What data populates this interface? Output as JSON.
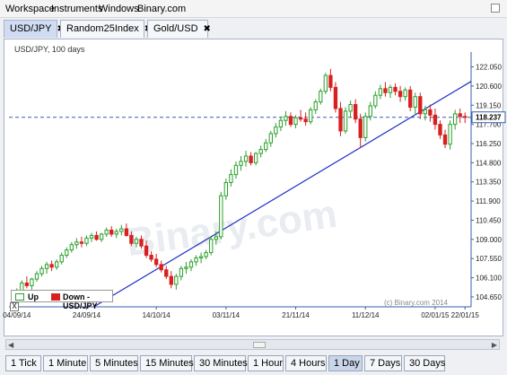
{
  "menu": {
    "workspace": "Workspace",
    "instruments": "Instruments",
    "windows": "Windows",
    "binary": "Binary.com"
  },
  "tabs": [
    {
      "label": "USD/JPY",
      "active": true
    },
    {
      "label": "Random25Index",
      "active": false
    },
    {
      "label": "Gold/USD",
      "active": false
    }
  ],
  "tab_close_glyph": "✖",
  "chart_subtitle": "USD/JPY, 100 days",
  "legend": {
    "up": "Up",
    "down": "Down - USD/JPY"
  },
  "close_box_glyph": "X",
  "copyright": "(c) Binary.com 2014",
  "watermark": "Binary.com",
  "current_price_label": "118.237",
  "periods": [
    {
      "label": "1 Tick",
      "active": false
    },
    {
      "label": "1 Minute",
      "active": false
    },
    {
      "label": "5 Minutes",
      "active": false
    },
    {
      "label": "15 Minutes",
      "active": false
    },
    {
      "label": "30 Minutes",
      "active": false
    },
    {
      "label": "1 Hour",
      "active": false
    },
    {
      "label": "4 Hours",
      "active": false
    },
    {
      "label": "1 Day",
      "active": true
    },
    {
      "label": "7 Days",
      "active": false
    },
    {
      "label": "30 Days",
      "active": false
    }
  ],
  "colors": {
    "up": "#2aa02a",
    "down": "#d92020",
    "trendline": "#1a2cc8",
    "price_line": "#3a5fa8",
    "axis": "#3a5fa8"
  },
  "chart_data": {
    "type": "candlestick",
    "title": "USD/JPY, 100 days",
    "ylim": [
      103.9,
      122.9
    ],
    "y_ticks": [
      "104.650",
      "106.100",
      "107.550",
      "109.000",
      "110.450",
      "111.900",
      "113.350",
      "114.800",
      "116.250",
      "117.700",
      "119.150",
      "120.600",
      "122.050"
    ],
    "x_tick_labels": [
      "04/09/14",
      "24/09/14",
      "14/10/14",
      "03/11/14",
      "21/11/14",
      "11/12/14",
      "02/01/15",
      "22/01/15"
    ],
    "current_price": 118.237,
    "trendline": {
      "from": [
        -1,
        100.2
      ],
      "to": [
        99,
        122.7
      ]
    },
    "candles": [
      [
        104.6,
        105.3,
        104.4,
        105.1
      ],
      [
        105.1,
        105.9,
        104.9,
        105.7
      ],
      [
        105.7,
        106.2,
        105.3,
        105.5
      ],
      [
        105.5,
        106.1,
        105.2,
        106.0
      ],
      [
        106.0,
        106.6,
        105.8,
        106.4
      ],
      [
        106.4,
        107.0,
        106.2,
        106.8
      ],
      [
        106.8,
        107.3,
        106.4,
        107.1
      ],
      [
        107.1,
        107.4,
        106.6,
        106.9
      ],
      [
        106.9,
        107.5,
        106.7,
        107.3
      ],
      [
        107.3,
        108.0,
        107.1,
        107.8
      ],
      [
        107.8,
        108.4,
        107.6,
        108.2
      ],
      [
        108.2,
        108.8,
        108.0,
        108.6
      ],
      [
        108.6,
        109.1,
        108.3,
        108.8
      ],
      [
        108.8,
        109.2,
        108.4,
        108.7
      ],
      [
        108.7,
        109.3,
        108.5,
        109.1
      ],
      [
        109.1,
        109.5,
        108.8,
        109.3
      ],
      [
        109.3,
        109.6,
        108.9,
        109.0
      ],
      [
        109.0,
        109.5,
        108.8,
        109.4
      ],
      [
        109.4,
        109.9,
        109.2,
        109.7
      ],
      [
        109.7,
        110.0,
        109.2,
        109.4
      ],
      [
        109.4,
        109.8,
        109.1,
        109.6
      ],
      [
        109.6,
        110.1,
        109.3,
        109.8
      ],
      [
        109.8,
        110.2,
        109.2,
        109.3
      ],
      [
        109.3,
        109.6,
        108.5,
        108.7
      ],
      [
        108.7,
        109.2,
        108.4,
        109.0
      ],
      [
        109.0,
        109.3,
        108.3,
        108.5
      ],
      [
        108.5,
        108.9,
        107.6,
        107.8
      ],
      [
        107.8,
        108.1,
        107.3,
        107.5
      ],
      [
        107.5,
        107.9,
        106.9,
        107.1
      ],
      [
        107.1,
        107.4,
        106.5,
        106.7
      ],
      [
        106.7,
        107.0,
        106.0,
        106.2
      ],
      [
        106.2,
        106.6,
        105.3,
        105.6
      ],
      [
        105.6,
        106.4,
        105.2,
        106.2
      ],
      [
        106.2,
        107.0,
        105.9,
        106.8
      ],
      [
        106.8,
        107.3,
        106.4,
        106.9
      ],
      [
        106.9,
        107.5,
        106.6,
        107.3
      ],
      [
        107.3,
        107.8,
        107.0,
        107.6
      ],
      [
        107.6,
        108.0,
        107.2,
        107.7
      ],
      [
        107.7,
        108.2,
        107.5,
        108.0
      ],
      [
        108.0,
        109.2,
        107.8,
        109.0
      ],
      [
        109.0,
        109.6,
        108.6,
        109.2
      ],
      [
        109.2,
        112.6,
        109.0,
        112.3
      ],
      [
        112.3,
        113.6,
        112.0,
        113.3
      ],
      [
        113.3,
        114.3,
        113.0,
        113.9
      ],
      [
        113.9,
        114.9,
        113.6,
        114.6
      ],
      [
        114.6,
        115.3,
        114.2,
        114.9
      ],
      [
        114.9,
        115.7,
        114.5,
        115.3
      ],
      [
        115.3,
        115.6,
        114.6,
        114.8
      ],
      [
        114.8,
        115.6,
        114.6,
        115.5
      ],
      [
        115.5,
        116.1,
        115.2,
        115.8
      ],
      [
        115.8,
        116.6,
        115.6,
        116.3
      ],
      [
        116.3,
        117.2,
        116.0,
        117.0
      ],
      [
        117.0,
        117.8,
        116.7,
        117.5
      ],
      [
        117.5,
        118.3,
        117.2,
        118.0
      ],
      [
        118.0,
        118.7,
        117.6,
        118.3
      ],
      [
        118.3,
        118.6,
        117.5,
        117.7
      ],
      [
        117.7,
        118.4,
        117.4,
        118.2
      ],
      [
        118.2,
        118.8,
        117.9,
        118.1
      ],
      [
        118.1,
        118.6,
        117.6,
        117.9
      ],
      [
        117.9,
        119.0,
        117.7,
        118.8
      ],
      [
        118.8,
        119.6,
        118.5,
        119.4
      ],
      [
        119.4,
        120.4,
        119.2,
        120.2
      ],
      [
        120.2,
        121.6,
        120.0,
        121.4
      ],
      [
        121.4,
        121.9,
        120.2,
        120.5
      ],
      [
        120.5,
        120.9,
        118.6,
        118.9
      ],
      [
        118.9,
        119.4,
        116.8,
        117.2
      ],
      [
        117.2,
        119.0,
        117.0,
        118.7
      ],
      [
        118.7,
        119.5,
        118.2,
        119.2
      ],
      [
        119.2,
        119.6,
        117.8,
        118.1
      ],
      [
        118.1,
        118.5,
        115.9,
        116.7
      ],
      [
        116.7,
        118.6,
        116.4,
        118.3
      ],
      [
        118.3,
        119.4,
        118.0,
        119.1
      ],
      [
        119.1,
        120.2,
        118.9,
        119.9
      ],
      [
        119.9,
        120.7,
        119.6,
        120.4
      ],
      [
        120.4,
        120.9,
        119.8,
        120.1
      ],
      [
        120.1,
        120.7,
        119.7,
        120.5
      ],
      [
        120.5,
        120.8,
        119.9,
        120.2
      ],
      [
        120.2,
        120.6,
        119.4,
        119.8
      ],
      [
        119.8,
        120.5,
        119.5,
        120.3
      ],
      [
        120.3,
        120.6,
        118.7,
        119.0
      ],
      [
        119.0,
        120.1,
        118.4,
        119.8
      ],
      [
        119.8,
        120.1,
        118.1,
        118.5
      ],
      [
        118.5,
        119.1,
        118.0,
        118.8
      ],
      [
        118.8,
        119.2,
        117.9,
        118.4
      ],
      [
        118.4,
        118.9,
        117.3,
        117.7
      ],
      [
        117.7,
        118.0,
        116.6,
        116.9
      ],
      [
        116.9,
        117.3,
        115.9,
        116.2
      ],
      [
        116.2,
        118.0,
        115.8,
        117.7
      ],
      [
        117.7,
        118.8,
        117.3,
        118.5
      ],
      [
        118.5,
        118.9,
        117.8,
        118.3
      ],
      [
        118.3,
        118.6,
        117.8,
        118.237
      ]
    ]
  }
}
